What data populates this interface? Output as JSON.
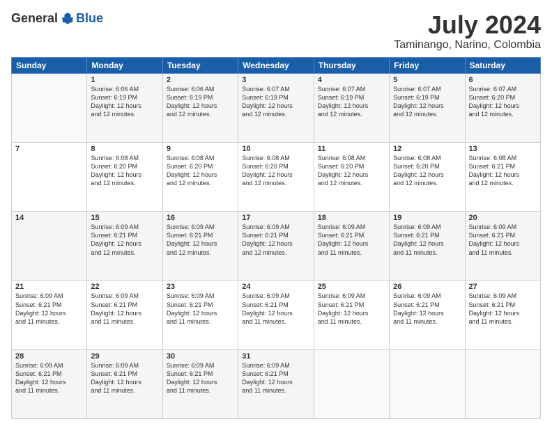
{
  "logo": {
    "general": "General",
    "blue": "Blue"
  },
  "title": {
    "month_year": "July 2024",
    "location": "Taminango, Narino, Colombia"
  },
  "days_header": [
    "Sunday",
    "Monday",
    "Tuesday",
    "Wednesday",
    "Thursday",
    "Friday",
    "Saturday"
  ],
  "weeks": [
    [
      {
        "day": "",
        "info": ""
      },
      {
        "day": "1",
        "info": "Sunrise: 6:06 AM\nSunset: 6:19 PM\nDaylight: 12 hours\nand 12 minutes."
      },
      {
        "day": "2",
        "info": "Sunrise: 6:06 AM\nSunset: 6:19 PM\nDaylight: 12 hours\nand 12 minutes."
      },
      {
        "day": "3",
        "info": "Sunrise: 6:07 AM\nSunset: 6:19 PM\nDaylight: 12 hours\nand 12 minutes."
      },
      {
        "day": "4",
        "info": "Sunrise: 6:07 AM\nSunset: 6:19 PM\nDaylight: 12 hours\nand 12 minutes."
      },
      {
        "day": "5",
        "info": "Sunrise: 6:07 AM\nSunset: 6:19 PM\nDaylight: 12 hours\nand 12 minutes."
      },
      {
        "day": "6",
        "info": "Sunrise: 6:07 AM\nSunset: 6:20 PM\nDaylight: 12 hours\nand 12 minutes."
      }
    ],
    [
      {
        "day": "7",
        "info": ""
      },
      {
        "day": "8",
        "info": "Sunrise: 6:08 AM\nSunset: 6:20 PM\nDaylight: 12 hours\nand 12 minutes."
      },
      {
        "day": "9",
        "info": "Sunrise: 6:08 AM\nSunset: 6:20 PM\nDaylight: 12 hours\nand 12 minutes."
      },
      {
        "day": "10",
        "info": "Sunrise: 6:08 AM\nSunset: 6:20 PM\nDaylight: 12 hours\nand 12 minutes."
      },
      {
        "day": "11",
        "info": "Sunrise: 6:08 AM\nSunset: 6:20 PM\nDaylight: 12 hours\nand 12 minutes."
      },
      {
        "day": "12",
        "info": "Sunrise: 6:08 AM\nSunset: 6:20 PM\nDaylight: 12 hours\nand 12 minutes."
      },
      {
        "day": "13",
        "info": "Sunrise: 6:08 AM\nSunset: 6:21 PM\nDaylight: 12 hours\nand 12 minutes."
      }
    ],
    [
      {
        "day": "14",
        "info": ""
      },
      {
        "day": "15",
        "info": "Sunrise: 6:09 AM\nSunset: 6:21 PM\nDaylight: 12 hours\nand 12 minutes."
      },
      {
        "day": "16",
        "info": "Sunrise: 6:09 AM\nSunset: 6:21 PM\nDaylight: 12 hours\nand 12 minutes."
      },
      {
        "day": "17",
        "info": "Sunrise: 6:09 AM\nSunset: 6:21 PM\nDaylight: 12 hours\nand 12 minutes."
      },
      {
        "day": "18",
        "info": "Sunrise: 6:09 AM\nSunset: 6:21 PM\nDaylight: 12 hours\nand 11 minutes."
      },
      {
        "day": "19",
        "info": "Sunrise: 6:09 AM\nSunset: 6:21 PM\nDaylight: 12 hours\nand 11 minutes."
      },
      {
        "day": "20",
        "info": "Sunrise: 6:09 AM\nSunset: 6:21 PM\nDaylight: 12 hours\nand 11 minutes."
      }
    ],
    [
      {
        "day": "21",
        "info": "Sunrise: 6:09 AM\nSunset: 6:21 PM\nDaylight: 12 hours\nand 11 minutes."
      },
      {
        "day": "22",
        "info": "Sunrise: 6:09 AM\nSunset: 6:21 PM\nDaylight: 12 hours\nand 11 minutes."
      },
      {
        "day": "23",
        "info": "Sunrise: 6:09 AM\nSunset: 6:21 PM\nDaylight: 12 hours\nand 11 minutes."
      },
      {
        "day": "24",
        "info": "Sunrise: 6:09 AM\nSunset: 6:21 PM\nDaylight: 12 hours\nand 11 minutes."
      },
      {
        "day": "25",
        "info": "Sunrise: 6:09 AM\nSunset: 6:21 PM\nDaylight: 12 hours\nand 11 minutes."
      },
      {
        "day": "26",
        "info": "Sunrise: 6:09 AM\nSunset: 6:21 PM\nDaylight: 12 hours\nand 11 minutes."
      },
      {
        "day": "27",
        "info": "Sunrise: 6:09 AM\nSunset: 6:21 PM\nDaylight: 12 hours\nand 11 minutes."
      }
    ],
    [
      {
        "day": "28",
        "info": "Sunrise: 6:09 AM\nSunset: 6:21 PM\nDaylight: 12 hours\nand 11 minutes."
      },
      {
        "day": "29",
        "info": "Sunrise: 6:09 AM\nSunset: 6:21 PM\nDaylight: 12 hours\nand 11 minutes."
      },
      {
        "day": "30",
        "info": "Sunrise: 6:09 AM\nSunset: 6:21 PM\nDaylight: 12 hours\nand 11 minutes."
      },
      {
        "day": "31",
        "info": "Sunrise: 6:09 AM\nSunset: 6:21 PM\nDaylight: 12 hours\nand 11 minutes."
      },
      {
        "day": "",
        "info": ""
      },
      {
        "day": "",
        "info": ""
      },
      {
        "day": "",
        "info": ""
      }
    ]
  ]
}
